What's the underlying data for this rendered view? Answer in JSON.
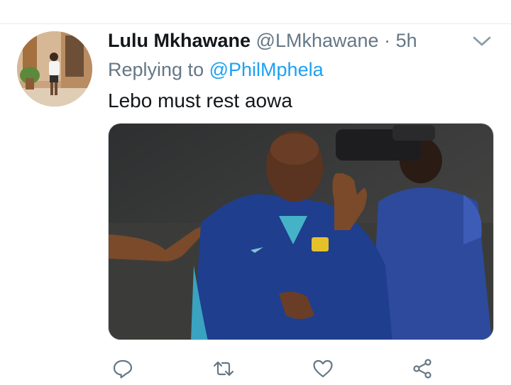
{
  "tweet": {
    "display_name": "Lulu Mkhawane",
    "handle": "@LMkhawane",
    "separator": "·",
    "time": "5h",
    "replying_prefix": "Replying to",
    "replying_to": "@PhilMphela",
    "text": "Lebo must rest aowa"
  },
  "icons": {
    "more": "chevron-down-icon",
    "reply": "reply-icon",
    "retweet": "retweet-icon",
    "like": "heart-icon",
    "share": "share-icon"
  },
  "colors": {
    "text": "#14171a",
    "secondary": "#657786",
    "link": "#1da1f2",
    "icon": "#657786"
  }
}
